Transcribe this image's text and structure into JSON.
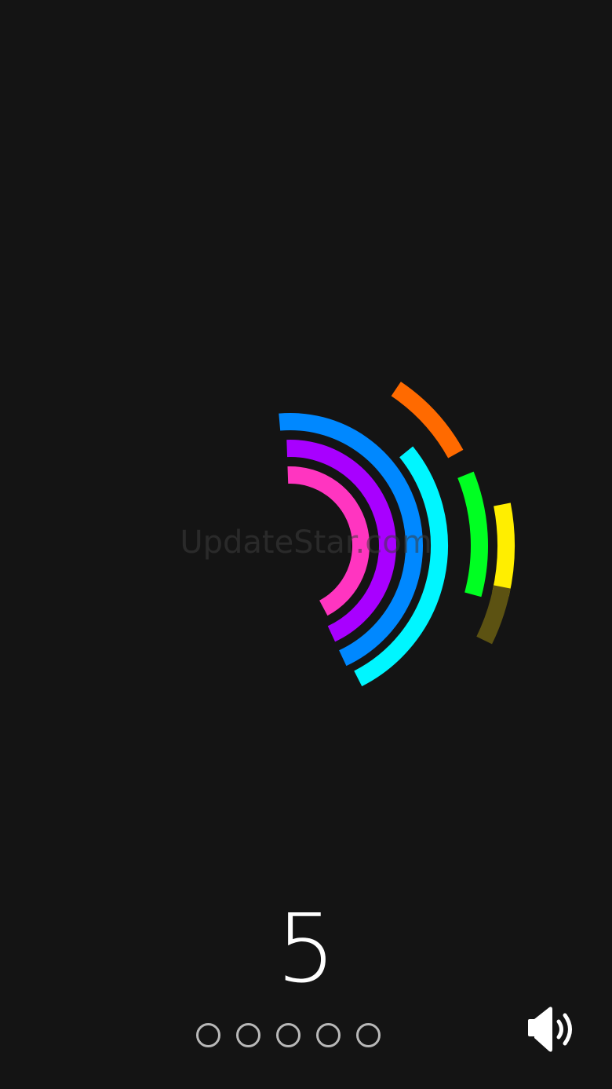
{
  "game": {
    "score": "5",
    "watermark": "UpdateStar.com",
    "lives_total": 5,
    "lives_filled": 0
  },
  "colors": {
    "background": "#141414",
    "orange": "#ff6a00",
    "blue": "#0088ff",
    "purple": "#a800ff",
    "pink": "#ff35c0",
    "cyan": "#00f6ff",
    "green": "#00ff22",
    "yellow": "#ffee00",
    "faded_yellow": "#5c5212"
  },
  "icons": {
    "sound": "speaker-volume-icon"
  }
}
